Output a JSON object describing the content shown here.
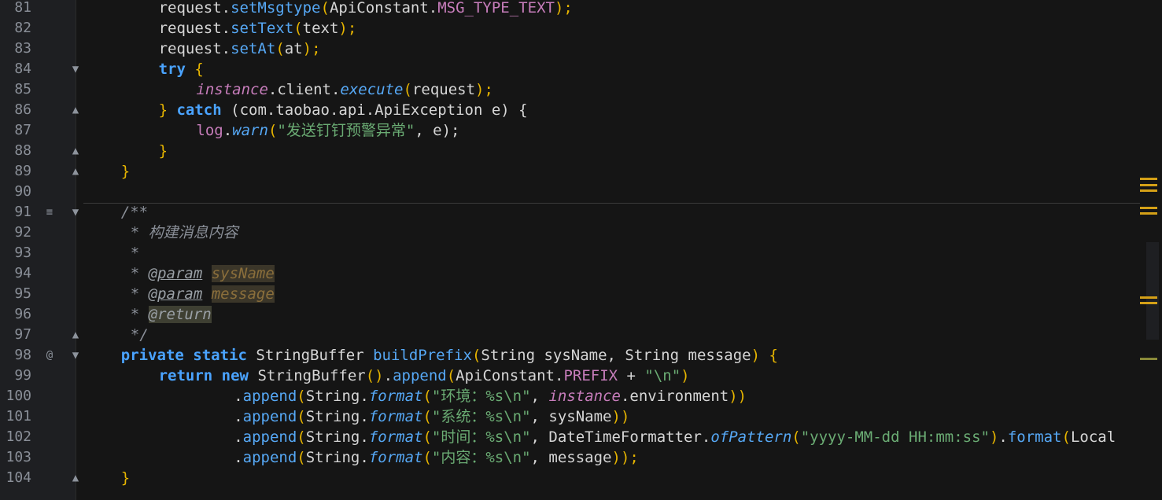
{
  "editor": {
    "lines": [
      {
        "n": "81",
        "fold": "",
        "mark": "",
        "indent": 8,
        "tokens": [
          [
            "request.",
            "t-default"
          ],
          [
            "setMsgtype",
            "t-method"
          ],
          [
            "(",
            "t-brace"
          ],
          [
            "ApiConstant.",
            "t-default"
          ],
          [
            "MSG_TYPE_TEXT",
            "t-constant"
          ],
          [
            ");",
            "t-brace"
          ]
        ]
      },
      {
        "n": "82",
        "fold": "",
        "mark": "",
        "indent": 8,
        "tokens": [
          [
            "request.",
            "t-default"
          ],
          [
            "setText",
            "t-method"
          ],
          [
            "(",
            "t-brace"
          ],
          [
            "text",
            "t-default"
          ],
          [
            ");",
            "t-brace"
          ]
        ]
      },
      {
        "n": "83",
        "fold": "",
        "mark": "",
        "indent": 8,
        "tokens": [
          [
            "request.",
            "t-default"
          ],
          [
            "setAt",
            "t-method"
          ],
          [
            "(",
            "t-brace"
          ],
          [
            "at",
            "t-default"
          ],
          [
            ");",
            "t-brace"
          ]
        ]
      },
      {
        "n": "84",
        "fold": "▼",
        "mark": "",
        "indent": 8,
        "tokens": [
          [
            "try",
            "t-kwblue"
          ],
          [
            " {",
            "t-brace"
          ]
        ]
      },
      {
        "n": "85",
        "fold": "",
        "mark": "",
        "indent": 12,
        "tokens": [
          [
            "instance",
            "t-italic-purple"
          ],
          [
            ".client.",
            "t-default"
          ],
          [
            "execute",
            "t-italic-method"
          ],
          [
            "(",
            "t-brace"
          ],
          [
            "request",
            "t-default"
          ],
          [
            ");",
            "t-brace"
          ]
        ]
      },
      {
        "n": "86",
        "fold": "▲",
        "mark": "",
        "indent": 8,
        "tokens": [
          [
            "} ",
            "t-brace"
          ],
          [
            "catch",
            "t-kwblue"
          ],
          [
            " (com.taobao.api.ApiException e) {",
            "t-default"
          ]
        ]
      },
      {
        "n": "87",
        "fold": "",
        "mark": "",
        "indent": 12,
        "tokens": [
          [
            "log",
            "t-constant"
          ],
          [
            ".",
            "t-default"
          ],
          [
            "warn",
            "t-italic-method"
          ],
          [
            "(",
            "t-brace"
          ],
          [
            "\"发送钉钉预警异常\"",
            "t-string"
          ],
          [
            ", e);",
            "t-default"
          ]
        ]
      },
      {
        "n": "88",
        "fold": "▲",
        "mark": "",
        "indent": 8,
        "tokens": [
          [
            "}",
            "t-brace"
          ]
        ]
      },
      {
        "n": "89",
        "fold": "▲",
        "mark": "",
        "indent": 4,
        "tokens": [
          [
            "}",
            "t-brace"
          ]
        ]
      },
      {
        "n": "90",
        "fold": "",
        "mark": "",
        "indent": 0,
        "tokens": []
      },
      {
        "n": "91",
        "fold": "▼",
        "mark": "≡",
        "indent": 4,
        "tokens": [
          [
            "/**",
            "t-comment"
          ]
        ]
      },
      {
        "n": "92",
        "fold": "",
        "mark": "",
        "indent": 5,
        "tokens": [
          [
            "* 构建消息内容",
            "t-comment"
          ]
        ]
      },
      {
        "n": "93",
        "fold": "",
        "mark": "",
        "indent": 5,
        "tokens": [
          [
            "*",
            "t-comment"
          ]
        ]
      },
      {
        "n": "94",
        "fold": "",
        "mark": "",
        "indent": 5,
        "tokens": [
          [
            "* ",
            "t-comment"
          ],
          [
            "@param",
            "t-tag"
          ],
          [
            " ",
            "t-comment"
          ],
          [
            "sysName",
            "t-paramhl"
          ]
        ]
      },
      {
        "n": "95",
        "fold": "",
        "mark": "",
        "indent": 5,
        "tokens": [
          [
            "* ",
            "t-comment"
          ],
          [
            "@param",
            "t-tag"
          ],
          [
            " ",
            "t-comment"
          ],
          [
            "message",
            "t-paramhl"
          ]
        ]
      },
      {
        "n": "96",
        "fold": "",
        "mark": "",
        "indent": 5,
        "tokens": [
          [
            "* ",
            "t-comment"
          ],
          [
            "@return",
            "t-returnhl"
          ]
        ]
      },
      {
        "n": "97",
        "fold": "▲",
        "mark": "",
        "indent": 5,
        "tokens": [
          [
            "*/",
            "t-comment"
          ]
        ]
      },
      {
        "n": "98",
        "fold": "▼",
        "mark": "@",
        "indent": 4,
        "tokens": [
          [
            "private static ",
            "t-kwblue"
          ],
          [
            "StringBuffer ",
            "t-default"
          ],
          [
            "buildPrefix",
            "t-method"
          ],
          [
            "(",
            "t-brace"
          ],
          [
            "String sysName, String message",
            "t-default"
          ],
          [
            ") {",
            "t-brace"
          ]
        ]
      },
      {
        "n": "99",
        "fold": "",
        "mark": "",
        "indent": 8,
        "tokens": [
          [
            "return new ",
            "t-kwblue"
          ],
          [
            "StringBuffer",
            "t-default"
          ],
          [
            "()",
            "t-brace"
          ],
          [
            ".",
            "t-default"
          ],
          [
            "append",
            "t-method"
          ],
          [
            "(",
            "t-brace"
          ],
          [
            "ApiConstant.",
            "t-default"
          ],
          [
            "PREFIX",
            "t-constant"
          ],
          [
            " + ",
            "t-default"
          ],
          [
            "\"\\n\"",
            "t-string"
          ],
          [
            ")",
            "t-brace"
          ]
        ]
      },
      {
        "n": "100",
        "fold": "",
        "mark": "",
        "indent": 16,
        "tokens": [
          [
            ".",
            "t-default"
          ],
          [
            "append",
            "t-method"
          ],
          [
            "(",
            "t-brace"
          ],
          [
            "String.",
            "t-default"
          ],
          [
            "format",
            "t-italic-method"
          ],
          [
            "(",
            "t-brace"
          ],
          [
            "\"环境：%s\\n\"",
            "t-string"
          ],
          [
            ", ",
            "t-default"
          ],
          [
            "instance",
            "t-italic-purple"
          ],
          [
            ".environment",
            "t-default"
          ],
          [
            "))",
            "t-brace"
          ]
        ]
      },
      {
        "n": "101",
        "fold": "",
        "mark": "",
        "indent": 16,
        "tokens": [
          [
            ".",
            "t-default"
          ],
          [
            "append",
            "t-method"
          ],
          [
            "(",
            "t-brace"
          ],
          [
            "String.",
            "t-default"
          ],
          [
            "format",
            "t-italic-method"
          ],
          [
            "(",
            "t-brace"
          ],
          [
            "\"系统：%s\\n\"",
            "t-string"
          ],
          [
            ", sysName",
            "t-default"
          ],
          [
            "))",
            "t-brace"
          ]
        ]
      },
      {
        "n": "102",
        "fold": "",
        "mark": "",
        "indent": 16,
        "tokens": [
          [
            ".",
            "t-default"
          ],
          [
            "append",
            "t-method"
          ],
          [
            "(",
            "t-brace"
          ],
          [
            "String.",
            "t-default"
          ],
          [
            "format",
            "t-italic-method"
          ],
          [
            "(",
            "t-brace"
          ],
          [
            "\"时间：%s\\n\"",
            "t-string"
          ],
          [
            ", DateTimeFormatter.",
            "t-default"
          ],
          [
            "ofPattern",
            "t-italic-method"
          ],
          [
            "(",
            "t-brace"
          ],
          [
            "\"yyyy-MM-dd HH:mm:ss\"",
            "t-string"
          ],
          [
            ")",
            "t-brace"
          ],
          [
            ".",
            "t-default"
          ],
          [
            "format",
            "t-method"
          ],
          [
            "(",
            "t-brace"
          ],
          [
            "Local",
            "t-default"
          ]
        ]
      },
      {
        "n": "103",
        "fold": "",
        "mark": "",
        "indent": 16,
        "tokens": [
          [
            ".",
            "t-default"
          ],
          [
            "append",
            "t-method"
          ],
          [
            "(",
            "t-brace"
          ],
          [
            "String.",
            "t-default"
          ],
          [
            "format",
            "t-italic-method"
          ],
          [
            "(",
            "t-brace"
          ],
          [
            "\"内容：%s\\n\"",
            "t-string"
          ],
          [
            ", message",
            "t-default"
          ],
          [
            "));",
            "t-brace"
          ]
        ]
      },
      {
        "n": "104",
        "fold": "▲",
        "mark": "",
        "indent": 4,
        "tokens": [
          [
            "}",
            "t-brace"
          ]
        ]
      }
    ]
  },
  "colors": {
    "background": "#151515",
    "gutter": "#1e1f22",
    "keyword": "#4aa3ff",
    "method": "#56a8f5",
    "string": "#6aab73",
    "constant": "#c77dbb",
    "brace": "#e6b400",
    "comment": "#8a8f98"
  },
  "scrollbar_marks": [
    "#d4a017",
    "#d4a017",
    "#d4a017",
    "#d4a017",
    "#d4a017"
  ]
}
